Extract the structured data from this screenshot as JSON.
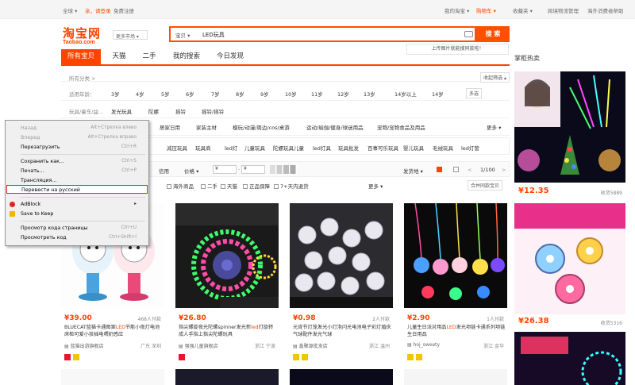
{
  "topbar": {
    "global": "全球 ▾",
    "greeting": "亲，请登录",
    "register": "免费注册",
    "my_taobao": "我的淘宝 ▾",
    "cart": "购物车 ▾",
    "favorites": "收藏夹 ▾",
    "cross_border": "跨境物流管理",
    "overseas": "海外消费者帮助"
  },
  "logo": {
    "text": "淘宝网",
    "sub": "Taobao.com"
  },
  "market_select": "更多市场 ▾",
  "search": {
    "scope": "宝贝 ▾",
    "query": "LED玩具",
    "button": "搜 索",
    "image_tip": "上传图片就能搜同款啦！"
  },
  "tabs": [
    "所有宝贝",
    "天猫",
    "二手",
    "我的搜索",
    "今日发现"
  ],
  "right_title": "掌柜热卖",
  "filters": {
    "breadcrumb": "所有分类 >",
    "collapse": "收起筛选 ▴",
    "age_label": "适用年龄：",
    "ages": [
      "3岁",
      "4岁",
      "5岁",
      "6岁",
      "7岁",
      "8岁",
      "9岁",
      "10岁",
      "11岁",
      "12岁",
      "13岁",
      "14岁以上",
      "14岁"
    ],
    "more_select": "多选",
    "toy_label": "玩具/童车/益...",
    "toys": [
      "发光玩具",
      "陀螺",
      "摇铃",
      "摇铃/摇铃"
    ],
    "row3": [
      "居家日用",
      "家装主材",
      "模玩/动漫/周边/cos/桌游",
      "运动/瑜伽/健身/球迷用品",
      "宠物/宠物食品及用品"
    ],
    "more": "更多 ▾",
    "row4": [
      "减压玩具",
      "玩具商",
      "led灯",
      "儿童玩具",
      "陀螺玩具儿童",
      "led灯具",
      "玩具批发",
      "百事可乐玩具",
      "婴儿玩具",
      "毛绒玩具",
      "led灯管"
    ]
  },
  "sortbar": {
    "credit": "信用",
    "price": "价格 ▾",
    "price_from": "¥",
    "price_to": "¥",
    "ship_from": "发货地 ▾",
    "page": "1/100",
    "prev": "<",
    "next": ">"
  },
  "checks": [
    "海外商品",
    "二手",
    "天猫",
    "正品保障",
    "7+天内退货"
  ],
  "checks_more": "更多 ▾",
  "merge_sellers": "合并同款宝贝",
  "products": [
    {
      "price": "¥39.00",
      "sold": "468人付款",
      "title_pre": "BLUECAT蓝猫卡通图案",
      "title_hl": "LED",
      "title_post": "节能小夜灯电池床柜可爱小孩插电喂奶感应",
      "shop": "▤ 蓝猫出游旗舰店",
      "loc": "广东 深圳"
    },
    {
      "price": "¥26.80",
      "sold": "",
      "title_pre": "指尖螺旋夜光陀螺spinner发光新",
      "title_hl": "led",
      "title_post": "灯旋转成人手指上指尖陀螺玩具",
      "shop": "▤ 强强儿童旗舰店",
      "loc": "浙江 宁波"
    },
    {
      "price": "¥0.98",
      "sold": "2人付款",
      "title_pre": "元宵节灯笼发光小灯泡闪光电池电子彩灯婚庆气球配件发光气球",
      "title_hl": "",
      "title_post": "",
      "shop": "▤ 鑫聚源批发店",
      "loc": "浙江 温州"
    },
    {
      "price": "¥2.90",
      "sold": "1人付款",
      "title_pre": "儿童生日派对用品",
      "title_hl": "LED",
      "title_post": "发光项链卡通系列项链生日用品",
      "shop": "▤ hoj_sweety",
      "loc": "浙江 金华"
    }
  ],
  "right_products": [
    {
      "price": "¥12.35",
      "sold": "收货5889"
    },
    {
      "price": "¥26.38",
      "sold": "收货5316"
    }
  ],
  "context_menu": {
    "items": [
      {
        "label": "Назад",
        "shortcut": "Alt+Стрелка влево",
        "disabled": true
      },
      {
        "label": "Вперед",
        "shortcut": "Alt+Стрелка вправо",
        "disabled": true
      },
      {
        "label": "Перезагрузить",
        "shortcut": "Ctrl+R",
        "disabled": false
      },
      {
        "label": "Сохранить как...",
        "shortcut": "Ctrl+S",
        "disabled": false
      },
      {
        "label": "Печать...",
        "shortcut": "Ctrl+P",
        "disabled": false
      },
      {
        "label": "Трансляция...",
        "shortcut": "",
        "disabled": false
      },
      {
        "label": "Перевести на русский",
        "shortcut": "",
        "disabled": false
      },
      {
        "label": "AdBlock",
        "shortcut": "▸",
        "disabled": false
      },
      {
        "label": "Save to Keep",
        "shortcut": "",
        "disabled": false
      },
      {
        "label": "Просмотр кода страницы",
        "shortcut": "Ctrl+U",
        "disabled": false
      },
      {
        "label": "Просмотреть код",
        "shortcut": "Ctrl+Shift+I",
        "disabled": false
      }
    ]
  },
  "colors": {
    "brand": "#ff4400",
    "menu_bg": "#f0f0f0",
    "highlight_border": "#e0261c"
  }
}
